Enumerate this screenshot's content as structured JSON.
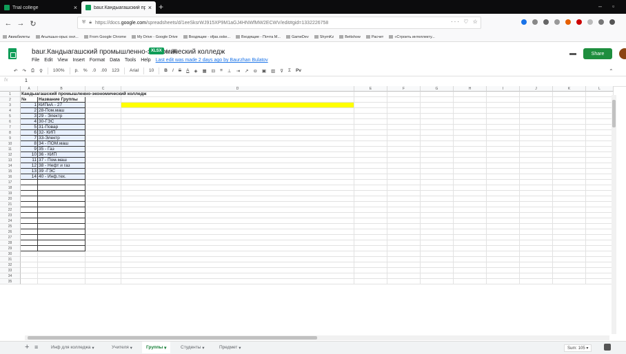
{
  "browser": {
    "tabs": [
      {
        "title": "Trial college",
        "active": false
      },
      {
        "title": "baur.Кандыагашский промышл",
        "active": true
      }
    ],
    "url_prefix": "https://docs.",
    "url_domain": "google.com",
    "url_rest": "/spreadsheets/d/1eeSksrWJ915XP9M1aGJ4HNWfMW2ECWV/edit#gid=1332226758",
    "url_actions": "··· ♡ ☆",
    "bookmarks": [
      "Авиабилеты",
      "Ағылшын-орыс онл...",
      "From Google Chrome",
      "My Drive - Google Drive",
      "Входящие - ofjas.oske...",
      "Входящие - Почта M...",
      "GameDev",
      "ShymKz",
      "Bettshow",
      "Расчет",
      "«Строить интеллекту..."
    ]
  },
  "doc": {
    "title": "baur.Кандыагашский промышленно-экономический колледж",
    "badge": "XLSX",
    "menu": [
      "File",
      "Edit",
      "View",
      "Insert",
      "Format",
      "Data",
      "Tools",
      "Help"
    ],
    "last_edit": "Last edit was made 2 days ago by Baurzhan Bulatov",
    "share_label": "Share"
  },
  "toolbar": {
    "zoom": "100%",
    "currency": "р.",
    "percent": "%",
    "dec_dec": ".0",
    "dec_inc": ".00",
    "format": "123",
    "font": "Arial",
    "font_size": "10"
  },
  "formula": {
    "fx": "fx",
    "value": "1"
  },
  "grid": {
    "columns": [
      "A",
      "B",
      "C",
      "D",
      "E",
      "F",
      "G",
      "H",
      "I",
      "J",
      "K",
      "L"
    ],
    "title_row": "Кандыагашский промышленно-экономический колледж",
    "header_no": "№",
    "header_group": "Название Группы",
    "rows": [
      {
        "n": "1",
        "name": "КИПиА - 27"
      },
      {
        "n": "2",
        "name": "28-Пом.маш"
      },
      {
        "n": "3",
        "name": "29 - Электр"
      },
      {
        "n": "4",
        "name": "30-ГЭС"
      },
      {
        "n": "5",
        "name": "31-Повар"
      },
      {
        "n": "6",
        "name": "32- КИП"
      },
      {
        "n": "7",
        "name": "33-Электр"
      },
      {
        "n": "8",
        "name": "34 - ПОМ.маш"
      },
      {
        "n": "9",
        "name": "35 - Газ"
      },
      {
        "n": "10",
        "name": "36 - КИП"
      },
      {
        "n": "11",
        "name": "37 - Пом.маш"
      },
      {
        "n": "12",
        "name": "38 - Нефт и газ"
      },
      {
        "n": "13",
        "name": "39 -ГЭС"
      },
      {
        "n": "14",
        "name": "40 - Инф.тех."
      }
    ],
    "row_count": 35
  },
  "sheets": {
    "tabs": [
      {
        "label": "Инф для колледжа",
        "active": false
      },
      {
        "label": "Учителя",
        "active": false
      },
      {
        "label": "Группы",
        "active": true
      },
      {
        "label": "Студенты",
        "active": false
      },
      {
        "label": "Предмет",
        "active": false
      }
    ],
    "sum": "Sum: 105"
  },
  "colors": {
    "accent": "#0f9d58",
    "highlight": "#ffff00",
    "selection": "#e8f0fe"
  }
}
